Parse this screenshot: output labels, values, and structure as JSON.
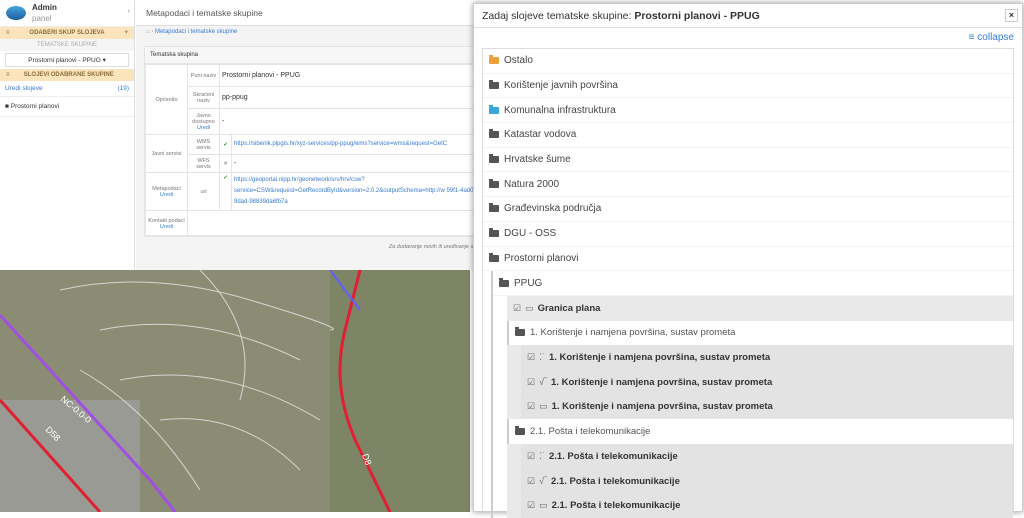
{
  "sidebar": {
    "brand_title": "Admin",
    "brand_sub": "panel",
    "collapse_icon": "‹",
    "choose_set": "ODABERI SKUP SLOJEVA",
    "add": "+",
    "thematic_label": "TEMATSKE SKUPINE",
    "selected_group": "Prostorni planovi - PPUG ▾",
    "layers_header": "SLOJEVI ODABRANE SKUPINE",
    "edit_layers": "Uredi slojeve",
    "layer_count": "(19)",
    "group_item": "Prostorni planovi"
  },
  "main": {
    "title": "Metapodaci i tematske skupine",
    "breadcrumb": "Metapodaci i tematske skupine",
    "card_title": "Tematska skupina",
    "opcenito": "Općenito",
    "puni_naziv_l": "Puni naziv",
    "puni_naziv": "Prostorni planovi - PPUG",
    "skraceni_l": "Skraćeni naziv",
    "skraceni": "pp-ppug",
    "javno_l": "Javno dostupno",
    "uredi": "Uredi",
    "dash": "-",
    "javni_servisi": "Javni servisi",
    "wms_l": "WMS servis",
    "wms_url": "https://sibenik.pipgis.hr/xyz-services/pp-ppug/wms?service=wms&request=GetC",
    "wfs_l": "WFS servis",
    "metapodaci_l": "Metapodaci",
    "url_l": "url",
    "meta_url": "https://geoportal.nipp.hr/geonetwork/srv/hrv/csw?service=CSW&request=GetRecordById&version=2.0.2&outputSchema=http://w 59f1-4ad0-9dad-98839da6fb7a",
    "kontakt_l": "Kontakt podaci",
    "footer": "Za dodavanje novih ili uređivanje sk"
  },
  "modal": {
    "title_prefix": "Zadaj slojeve tematske skupine: ",
    "title_group": "Prostorni planovi - PPUG",
    "close": "×",
    "collapse": "collapse",
    "folders": [
      {
        "label": "Ostalo",
        "color": "#e8a33c"
      },
      {
        "label": "Korištenje javnih površina",
        "color": "#555"
      },
      {
        "label": "Komunalna infrastruktura",
        "color": "#3aa6d8"
      },
      {
        "label": "Katastar vodova",
        "color": "#555"
      },
      {
        "label": "Hrvatske šume",
        "color": "#555"
      },
      {
        "label": "Natura 2000",
        "color": "#555"
      },
      {
        "label": "Građevinska područja",
        "color": "#555"
      },
      {
        "label": "DGU - OSS",
        "color": "#555"
      },
      {
        "label": "Prostorni planovi",
        "color": "#555"
      }
    ],
    "ppug": "PPUG",
    "granica": "Granica plana",
    "sub1": "1. Korištenje i namjena površina, sustav prometa",
    "sub1_leaves": [
      "1. Korištenje i namjena površina, sustav prometa",
      "1. Korištenje i namjena površina, sustav prometa",
      "1. Korištenje i namjena površina, sustav prometa"
    ],
    "sub2": "2.1. Pošta i telekomunikacije",
    "sub2_leaves": [
      "2.1. Pošta i telekomunikacije",
      "2.1. Pošta i telekomunikacije",
      "2.1. Pošta i telekomunikacije"
    ]
  },
  "map": {
    "road1": "NC-0.0-0",
    "road2": "D58",
    "road3": "D8"
  }
}
